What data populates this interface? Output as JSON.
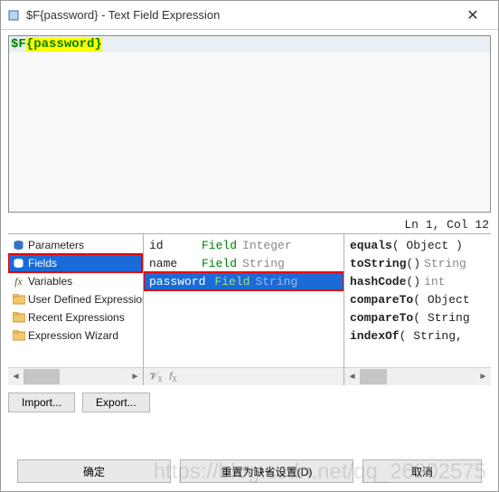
{
  "titlebar": {
    "title": "$F{password} - Text Field Expression"
  },
  "editor": {
    "tokens": [
      {
        "text": "$F",
        "hl": false
      },
      {
        "text": "{password}",
        "hl": true
      }
    ]
  },
  "status": {
    "text": "Ln 1, Col 12"
  },
  "left_panel": {
    "items": [
      {
        "icon": "db",
        "label": "Parameters",
        "selected": false
      },
      {
        "icon": "db",
        "label": "Fields",
        "selected": true,
        "highlight": true
      },
      {
        "icon": "fx",
        "label": "Variables",
        "selected": false
      },
      {
        "icon": "folder",
        "label": "User Defined Expressions",
        "selected": false
      },
      {
        "icon": "folder",
        "label": "Recent Expressions",
        "selected": false
      },
      {
        "icon": "folder",
        "label": "Expression Wizard",
        "selected": false
      }
    ]
  },
  "mid_panel": {
    "fields": [
      {
        "name": "id",
        "kw": "Field",
        "type": "Integer",
        "selected": false
      },
      {
        "name": "name",
        "kw": "Field",
        "type": "String",
        "selected": false
      },
      {
        "name": "password",
        "kw": "Field",
        "type": "String",
        "selected": true,
        "highlight": true
      }
    ]
  },
  "right_panel": {
    "methods": [
      {
        "name": "equals",
        "args": "( Object )",
        "ret": ""
      },
      {
        "name": "toString",
        "args": "()",
        "ret": "String"
      },
      {
        "name": "hashCode",
        "args": "()",
        "ret": "int"
      },
      {
        "name": "compareTo",
        "args": "( Object",
        "ret": ""
      },
      {
        "name": "compareTo",
        "args": "( String",
        "ret": ""
      },
      {
        "name": "indexOf",
        "args": "( String,",
        "ret": ""
      }
    ]
  },
  "buttons": {
    "import": "Import...",
    "export": "Export...",
    "ok": "确定",
    "reset": "重置为缺省设置(D)",
    "cancel": "取消"
  },
  "watermark": "https://blog.csdn.net/qq_26902575"
}
